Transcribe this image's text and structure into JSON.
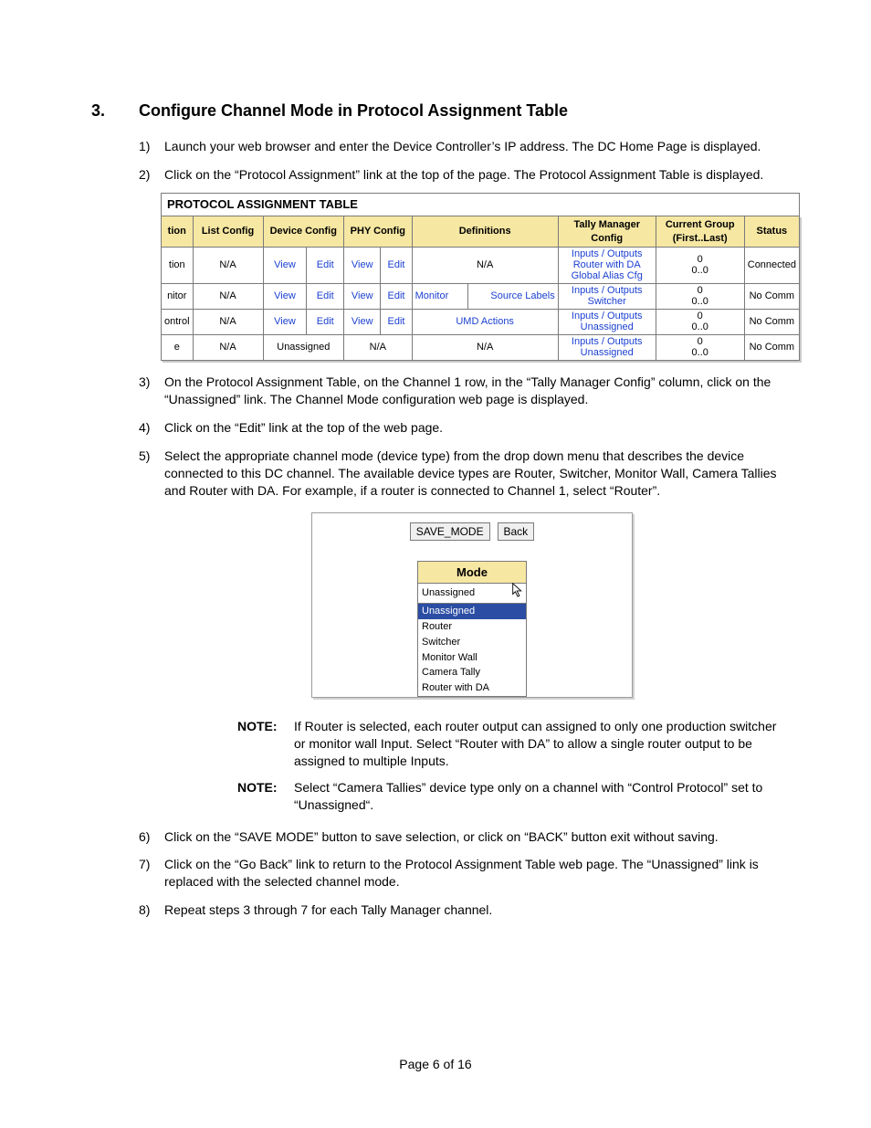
{
  "section": {
    "number": "3.",
    "title": "Configure Channel Mode in Protocol Assignment Table"
  },
  "steps": {
    "s1": {
      "marker": "1)",
      "text": "Launch your web browser and enter the Device Controller’s IP address. The DC Home Page is displayed."
    },
    "s2": {
      "marker": "2)",
      "text": "Click on the “Protocol Assignment” link at the top of the page.  The Protocol Assignment Table is displayed."
    },
    "s3": {
      "marker": "3)",
      "text": "On the Protocol Assignment Table, on the Channel 1 row, in the “Tally Manager Config” column, click on the “Unassigned” link.  The Channel Mode configuration web page is displayed."
    },
    "s4": {
      "marker": "4)",
      "text": "Click on the “Edit” link at the top of the web page."
    },
    "s5": {
      "marker": "5)",
      "text": "Select the appropriate channel mode (device type) from the drop down menu that describes the device connected to this DC channel.  The available device types are Router, Switcher, Monitor Wall, Camera Tallies and Router with DA.  For example, if a router is connected to Channel 1, select “Router”."
    },
    "s6": {
      "marker": "6)",
      "text": "Click on the “SAVE MODE” button to save selection, or click on “BACK” button exit without saving."
    },
    "s7": {
      "marker": "7)",
      "text": "Click on the “Go Back” link to return to the Protocol Assignment Table web page. The “Unassigned” link is replaced with the selected channel mode."
    },
    "s8": {
      "marker": "8)",
      "text": "Repeat steps 3 through 7 for each Tally Manager channel."
    }
  },
  "notes": {
    "label": "NOTE:",
    "n1": "If Router is selected, each router output can assigned to only one production switcher or monitor wall Input. Select “Router with DA” to allow a single router output to be assigned to multiple Inputs.",
    "n2": "Select “Camera Tallies” device type only on a channel with “Control Protocol” set to “Unassigned“."
  },
  "pat": {
    "title": "PROTOCOL ASSIGNMENT TABLE",
    "headers": {
      "c0": "tion",
      "c1": "List Config",
      "c2": "Device Config",
      "c3": "PHY Config",
      "c4": "Definitions",
      "c5": "Tally Manager Config",
      "c6": "Current Group (First..Last)",
      "c7": "Status"
    },
    "link": {
      "view": "View",
      "edit": "Edit",
      "inputs_outputs": "Inputs / Outputs",
      "router_da": "Router with DA",
      "global_alias": "Global Alias Cfg",
      "switcher": "Switcher",
      "unassigned": "Unassigned",
      "umd_actions": "UMD Actions",
      "monitor": "Monitor",
      "source_labels": "Source Labels"
    },
    "plain": {
      "na": "N/A",
      "unassigned": "Unassigned",
      "cg0": "0",
      "cgRange": "0..0",
      "connected": "Connected",
      "nocomm": "No Comm"
    },
    "rows": {
      "r0_c0": "tion",
      "r1_c0": "nitor",
      "r2_c0": "ontrol",
      "r3_c0": "e"
    }
  },
  "mode": {
    "save_btn": "SAVE_MODE",
    "back_btn": "Back",
    "header": "Mode",
    "selected_text": "Unassigned",
    "options": {
      "o0": "Unassigned",
      "o1": "Router",
      "o2": "Switcher",
      "o3": "Monitor Wall",
      "o4": "Camera Tally",
      "o5": "Router with DA"
    }
  },
  "footer": "Page 6 of 16"
}
